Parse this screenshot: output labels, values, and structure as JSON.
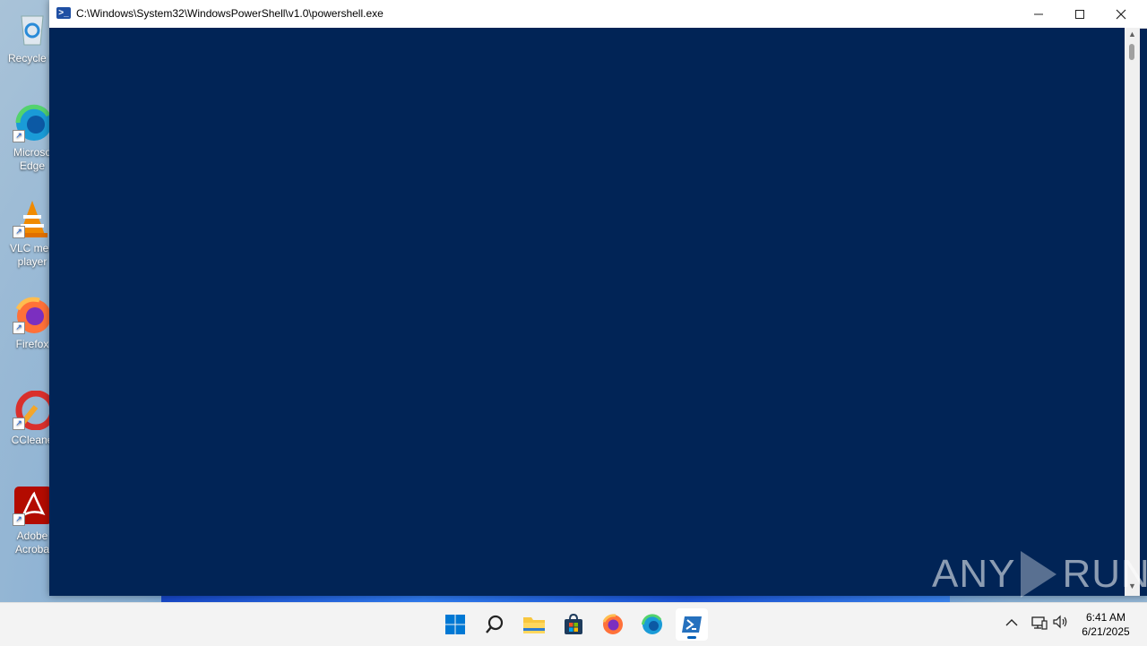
{
  "desktop": {
    "icons": [
      {
        "label": "Recycle B",
        "icon": "recycle-bin-icon"
      },
      {
        "label": "Microso Edge",
        "icon": "edge-icon"
      },
      {
        "label": "VLC med player",
        "icon": "vlc-icon"
      },
      {
        "label": "Firefox",
        "icon": "firefox-icon"
      },
      {
        "label": "CCleane",
        "icon": "ccleaner-icon"
      },
      {
        "label": "Adobe Acroba",
        "icon": "acrobat-icon"
      }
    ]
  },
  "window": {
    "title": "C:\\Windows\\System32\\WindowsPowerShell\\v1.0\\powershell.exe",
    "minimize_glyph": "—",
    "maximize_glyph": "☐",
    "close_glyph": "✕",
    "console_background": "#012456"
  },
  "watermark": {
    "left": "ANY",
    "right": "RUN"
  },
  "taskbar": {
    "items": [
      {
        "name": "start",
        "icon": "windows-logo-icon"
      },
      {
        "name": "search",
        "icon": "search-icon"
      },
      {
        "name": "file-explorer",
        "icon": "folder-icon"
      },
      {
        "name": "store",
        "icon": "store-icon"
      },
      {
        "name": "firefox",
        "icon": "firefox-icon"
      },
      {
        "name": "edge",
        "icon": "edge-icon"
      },
      {
        "name": "powershell",
        "icon": "powershell-icon",
        "active": true
      }
    ],
    "clock": {
      "time": "6:41 AM",
      "date": "6/21/2025"
    }
  }
}
